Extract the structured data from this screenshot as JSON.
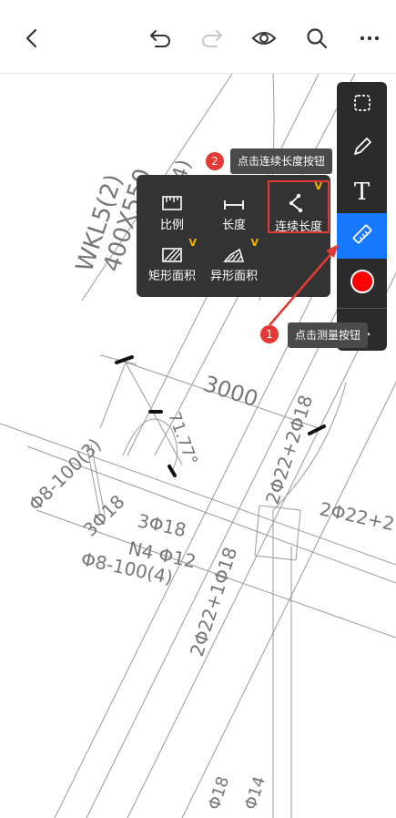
{
  "toolbar": {
    "back_icon": "chevron-left-icon",
    "undo_icon": "undo-icon",
    "redo_icon": "redo-icon",
    "view_icon": "eye-icon",
    "search_icon": "search-icon",
    "more_icon": "more-icon"
  },
  "right_tools": [
    {
      "icon": "select-region-icon"
    },
    {
      "icon": "pen-icon"
    },
    {
      "icon": "text-icon",
      "label": "T"
    },
    {
      "icon": "ruler-icon",
      "active": true
    },
    {
      "icon": "color-dot-icon",
      "color": "#ff0000"
    },
    {
      "icon": "chevron-up-icon"
    }
  ],
  "measure_menu": {
    "items": [
      {
        "label": "比例",
        "icon": "scale-ruler-icon"
      },
      {
        "label": "长度",
        "icon": "length-icon"
      },
      {
        "label": "连续长度",
        "icon": "polyline-length-icon",
        "vip": "V",
        "selected": true
      },
      {
        "label": "矩形面积",
        "icon": "rect-area-icon",
        "vip": "V"
      },
      {
        "label": "异形面积",
        "icon": "irregular-area-icon",
        "vip": "V"
      }
    ]
  },
  "tips": {
    "step1_badge": "1",
    "step1_text": "点击测量按钮",
    "step2_badge": "2",
    "step2_text": "点击连续长度按钮"
  },
  "drawing_text": {
    "beam": "WKL5(2)",
    "section": "400X550",
    "stirrup_top": "Φ8-100(4)",
    "dim": "3000",
    "angle": "71.77°",
    "rebar_a": "2Φ22+2Φ18",
    "rebar_b": "2Φ22+2",
    "stirrup_left": "Φ8-100(3)",
    "bot_a": "3Φ18",
    "bot_b": "3Φ18",
    "n4": "N4 Φ12",
    "stirrup_c": "Φ8-100(4)",
    "rebar_c": "2Φ22+1Φ18",
    "bot_c": "Φ18",
    "bot_d": "Φ14"
  },
  "colors": {
    "accent": "#1677ff",
    "annotation": "#e53935",
    "vip": "#f5b800"
  }
}
